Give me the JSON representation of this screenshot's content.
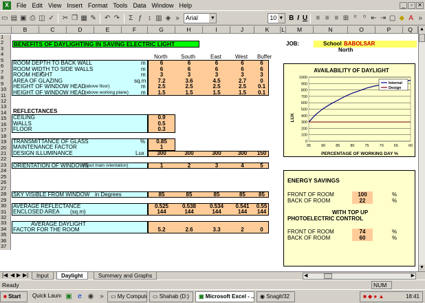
{
  "menu": [
    "File",
    "Edit",
    "View",
    "Insert",
    "Format",
    "Tools",
    "Data",
    "Window",
    "Help"
  ],
  "toolbar": {
    "font": "Arial",
    "size": "10"
  },
  "columns": [
    "B",
    "C",
    "D",
    "E",
    "F",
    "G",
    "H",
    "I",
    "J",
    "K",
    "L",
    "M",
    "N",
    "O",
    "P",
    "Q"
  ],
  "rows": [
    "1",
    "2",
    "3",
    "4",
    "5",
    "6",
    "7",
    "8",
    "9",
    "10",
    "11",
    "12",
    "13",
    "14",
    "15",
    "16",
    "17",
    "18",
    "19",
    "20",
    "21",
    "22",
    "23",
    "24",
    "25",
    "26",
    "27",
    "28",
    "29",
    "30",
    "31",
    "32",
    "33",
    "34",
    "35",
    "36",
    "37"
  ],
  "sheet": {
    "title": "BENEFITS OF DAYLIGHTING IN SAVING ELECTRIC LIGHT",
    "job_label": "JOB:",
    "job_school": "School",
    "job_name": "BABOLSAR",
    "job_orientation": "North",
    "headers": [
      "North",
      "South",
      "East",
      "West",
      "Buffer"
    ],
    "room_rows": [
      {
        "label": "ROOM DEPTH TO BACK WALL",
        "unit": "m",
        "values": [
          "6",
          "6",
          "6",
          "6",
          "6"
        ]
      },
      {
        "label": "ROOM WIDTH TO SIDE WALLS",
        "unit": "m",
        "values": [
          "6",
          "6",
          "6",
          "6",
          "6"
        ]
      },
      {
        "label": "ROOM HEIGHT",
        "unit": "m",
        "values": [
          "3",
          "3",
          "3",
          "3",
          "3"
        ]
      },
      {
        "label": "AREA OF GLAZING",
        "unit": "sq.m",
        "values": [
          "7.2",
          "3.6",
          "4.5",
          "2.7",
          "0"
        ]
      },
      {
        "label": "HEIGHT OF WINDOW HEAD",
        "sub": "(above floor)",
        "unit": "m",
        "values": [
          "2.5",
          "2.5",
          "2.5",
          "2.5",
          "0.1"
        ]
      },
      {
        "label": "HEIGHT OF WINDOW HEAD",
        "sub": "(above working plane)",
        "unit": "m",
        "values": [
          "1.5",
          "1.5",
          "1.5",
          "1.5",
          "0.1"
        ]
      }
    ],
    "reflectances_label": "REFLECTANCES",
    "reflect_rows": [
      {
        "label": "CEILING",
        "value": "0.9"
      },
      {
        "label": "WALLS",
        "value": "0.5"
      },
      {
        "label": "FLOOR",
        "value": "0.3"
      }
    ],
    "transmittance": {
      "label": "TRANSMITTANCE OF GLASS",
      "unit": "%",
      "value": "0.85"
    },
    "maintenance": {
      "label": "MAINTENANCE FACTOR",
      "value": "1"
    },
    "design_illum": {
      "label": "DESIGN ILLUMINANCE",
      "unit": "Lux",
      "values": [
        "300",
        "300",
        "300",
        "300",
        "150"
      ]
    },
    "orientation": {
      "label": "ORIENTATION OF WINDOWS",
      "sub": "(input main orientation)",
      "values": [
        "1",
        "2",
        "3",
        "4",
        "5"
      ]
    },
    "sky": {
      "label": "SKY VISIBLE FROM WINDOW",
      "sub": "in Degrees",
      "values": [
        "85",
        "85",
        "85",
        "85",
        "85"
      ]
    },
    "avg_reflect": {
      "label": "AVERAGE REFLECTANCE",
      "values": [
        "0.525",
        "0.538",
        "0.534",
        "0.541",
        "0.55"
      ]
    },
    "enclosed": {
      "label": "ENCLOSED AREA",
      "sub": "(sq.m)",
      "values": [
        "144",
        "144",
        "144",
        "144",
        "144"
      ]
    },
    "adf": {
      "label1": "AVERAGE DAYLIGHT",
      "label2": "FACTOR FOR THE ROOM",
      "values": [
        "5.2",
        "2.6",
        "3.3",
        "2",
        "0"
      ]
    }
  },
  "energy": {
    "title": "ENERGY SAVINGS",
    "front_label": "FRONT OF ROOM",
    "front_value": "100",
    "back_label": "BACK OF ROOM",
    "back_value": "22",
    "pct": "%",
    "with_top_up": "WITH TOP UP",
    "photo": "PHOTOELECTRIC CONTROL",
    "front2_value": "74",
    "back2_value": "60"
  },
  "chart_data": {
    "type": "line",
    "title": "AVAILABILITY OF DAYLIGHT",
    "xlabel": "PERCENTAGE OF WORKING DAY  %",
    "ylabel": "LUX",
    "xlim": [
      95,
      60
    ],
    "ylim": [
      0,
      1000
    ],
    "xticks": [
      "95",
      "90",
      "85",
      "80",
      "75",
      "70",
      "65",
      "60"
    ],
    "yticks": [
      "0",
      "100",
      "200",
      "300",
      "400",
      "500",
      "600",
      "700",
      "800",
      "900",
      "1000"
    ],
    "legend": "top-right",
    "series": [
      {
        "name": "Internal",
        "color": "#000080",
        "x": [
          95,
          92.5,
          90,
          87.5,
          85,
          82.5,
          80,
          77.5,
          75,
          72.5,
          70,
          67.5,
          65,
          62.5,
          60
        ],
        "y": [
          300,
          420,
          510,
          580,
          640,
          700,
          750,
          790,
          830,
          860,
          880,
          900,
          910,
          930,
          950
        ]
      },
      {
        "name": "Design",
        "color": "#800000",
        "x": [
          95,
          60
        ],
        "y": [
          300,
          300
        ]
      }
    ]
  },
  "tabs": [
    "Input",
    "Daylight",
    "Summary and Graphs"
  ],
  "status": {
    "ready": "Ready",
    "num": "NUM"
  },
  "taskbar": [
    "Start",
    "Quick Launch",
    "My Computer",
    "Shahab (D:)",
    "Microsoft Excel - ...",
    "Snagit/32"
  ],
  "clock": "18:41"
}
